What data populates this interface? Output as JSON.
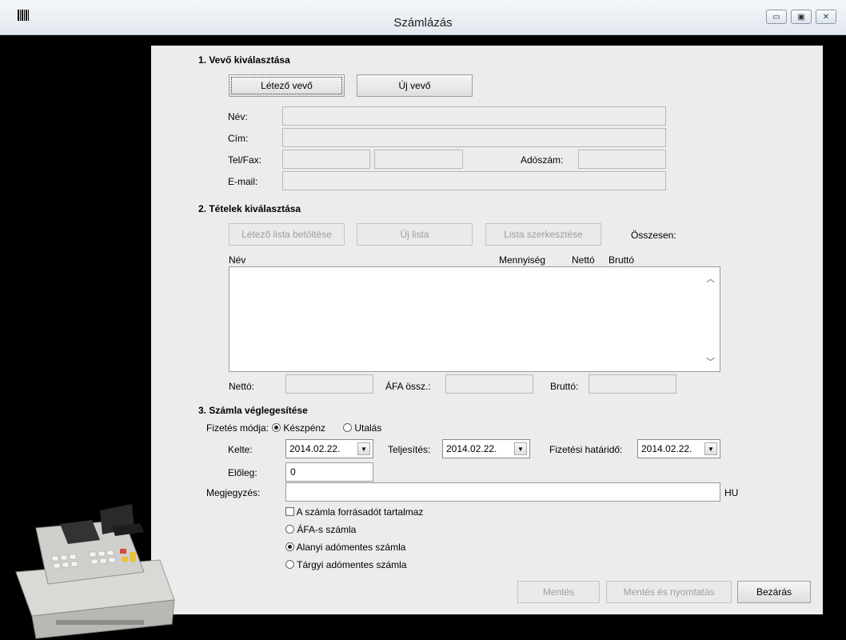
{
  "window": {
    "title": "Számlázás"
  },
  "section1": {
    "heading": "1. Vevő kiválasztása",
    "existing_button": "Létező vevő",
    "new_button": "Új vevő",
    "name_label": "Név:",
    "address_label": "Cím:",
    "telfax_label": "Tel/Fax:",
    "taxno_label": "Adószám:",
    "email_label": "E-mail:"
  },
  "section2": {
    "heading": "2. Tételek kiválasztása",
    "load_list_button": "Létező lista betöltése",
    "new_list_button": "Új lista",
    "edit_list_button": "Lista szerkesztése",
    "total_label": "Összesen:",
    "columns": [
      "Név",
      "Mennyiség",
      "Nettó",
      "Bruttó"
    ],
    "net_label": "Nettó:",
    "vat_label": "ÁFA össz.:",
    "gross_label": "Bruttó:"
  },
  "section3": {
    "heading": "3. Számla véglegesítése",
    "payment_label": "Fizetés módja:",
    "payment_options": [
      "Készpénz",
      "Utalás"
    ],
    "issued_label": "Kelte:",
    "issued_value": "2014.02.22.",
    "fulfil_label": "Teljesítés:",
    "fulfil_value": "2014.02.22.",
    "due_label": "Fizetési határidő:",
    "due_value": "2014.02.22.",
    "advance_label": "Előleg:",
    "advance_value": "0",
    "note_label": "Megjegyzés:",
    "note_suffix": "HU",
    "source_tax_checkbox": "A számla forrásadót tartalmaz",
    "invoice_types": [
      "ÁFA-s számla",
      "Alanyi adómentes számla",
      "Tárgyi adómentes számla"
    ],
    "selected_invoice_type": "Alanyi adómentes számla"
  },
  "footer": {
    "save_button": "Mentés",
    "save_print_button": "Mentés és nyomtatás",
    "close_button": "Bezárás"
  }
}
